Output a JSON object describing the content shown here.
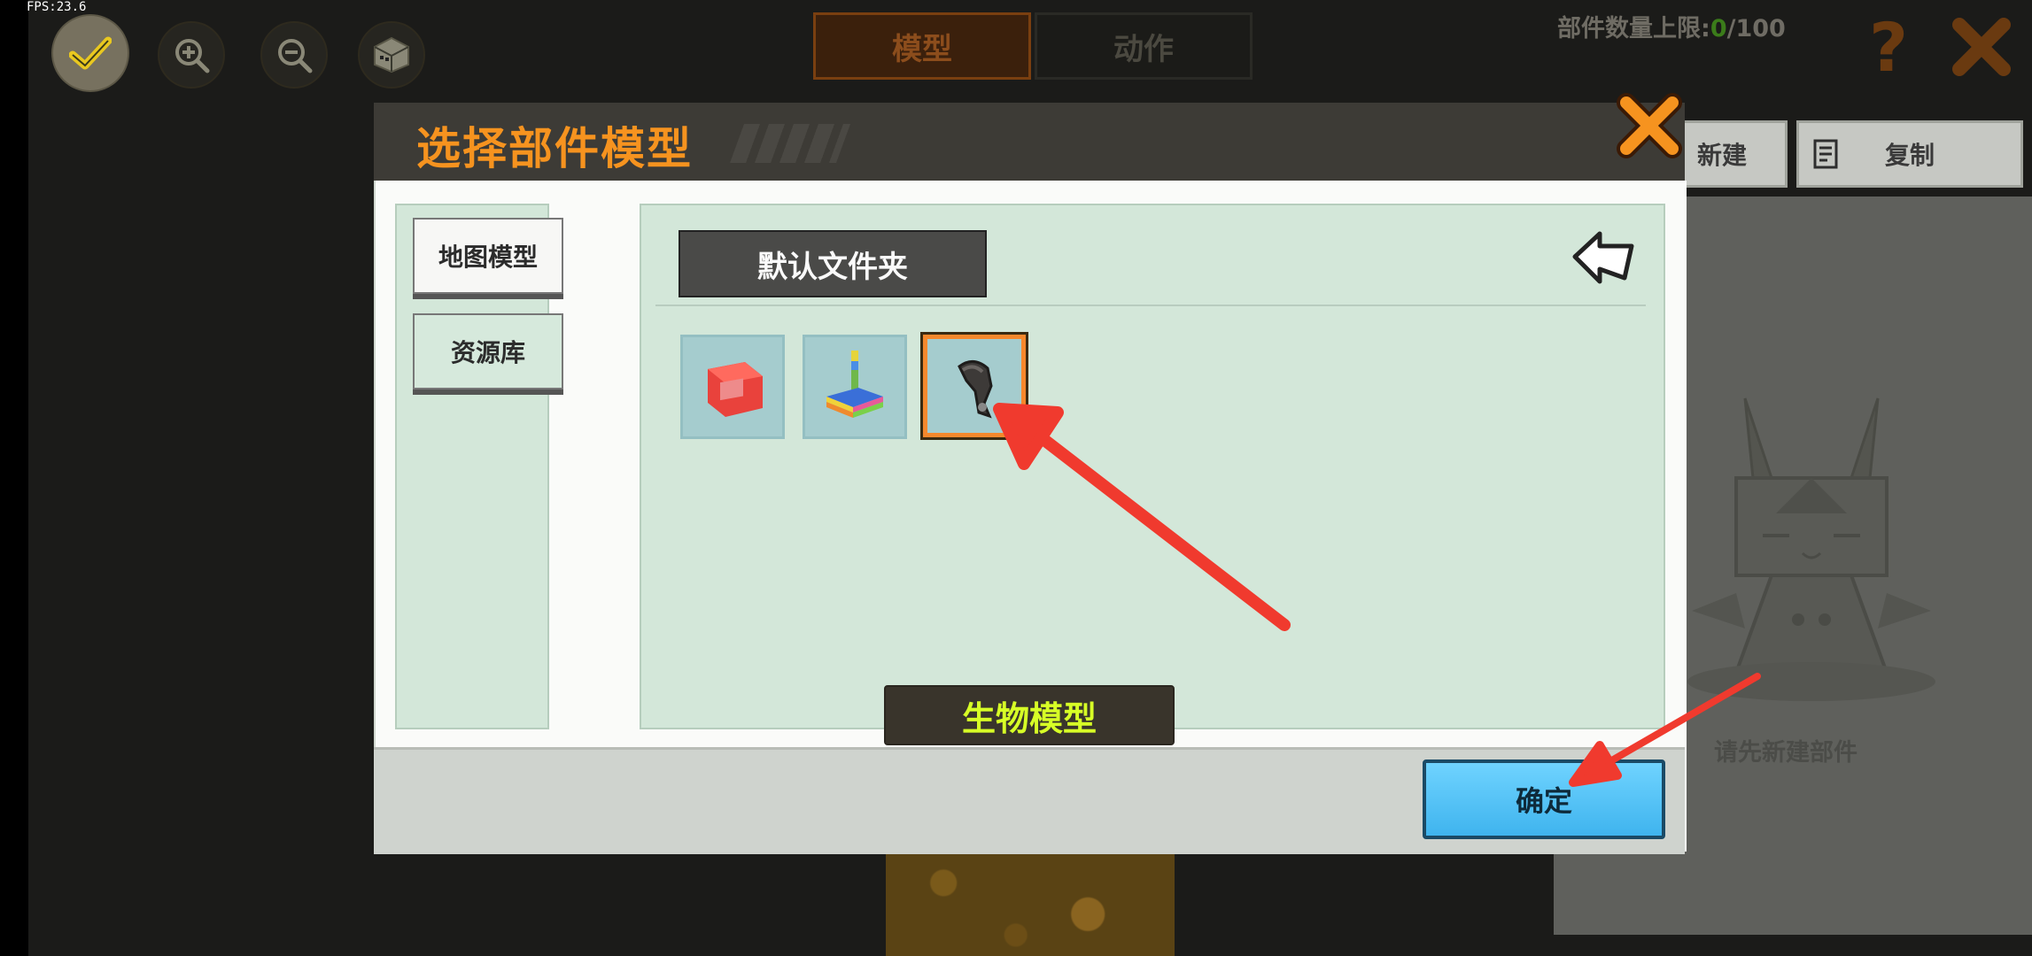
{
  "fps": "FPS:23.6",
  "tabs": {
    "model": "模型",
    "action": "动作"
  },
  "limit": {
    "prefix": "部件数量上限:",
    "current": "0",
    "suffix": "/100"
  },
  "right_panel": {
    "new_label": "新建",
    "copy_label": "复制",
    "empty_text": "请先新建部件"
  },
  "dialog": {
    "title": "选择部件模型",
    "sidebar": [
      "地图模型",
      "资源库"
    ],
    "folder": "默认文件夹",
    "tooltip": "生物模型",
    "confirm": "确定",
    "items": [
      {
        "icon": "red-frame-block-icon"
      },
      {
        "icon": "rainbow-lever-icon"
      },
      {
        "icon": "creature-tail-icon",
        "selected": true
      }
    ]
  },
  "colors": {
    "accent_orange": "#f6931f",
    "tooltip_text": "#d7ff26",
    "confirm_blue": "#4fc3f7",
    "annotation_red": "#f03a2e"
  }
}
